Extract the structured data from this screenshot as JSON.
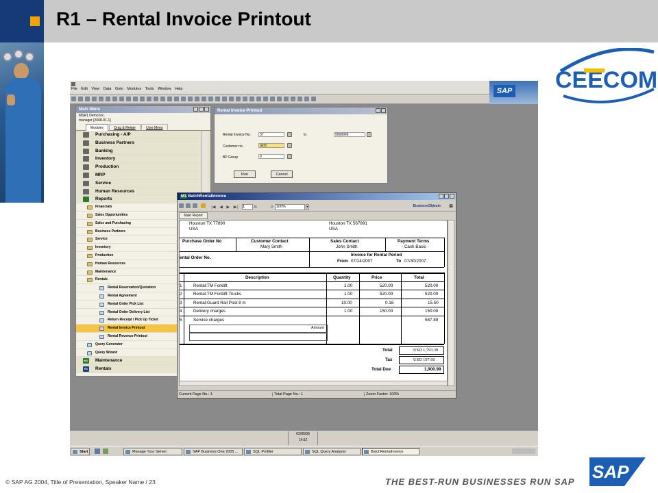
{
  "slide": {
    "title": "R1 – Rental Invoice Printout",
    "footer": "© SAP AG 2004, Title of Presentation, Speaker Name / 23",
    "tagline": "THE BEST-RUN BUSINESSES RUN SAP",
    "logo_text": "CEECOM",
    "sap_logo": "SAP",
    "colors": {
      "header_bg": "#c9c9c9",
      "header_blue": "#163a78",
      "accent_orange": "#f0a400",
      "sap_blue": "#1c5fb2"
    }
  },
  "app": {
    "menubar": [
      "File",
      "Edit",
      "View",
      "Data",
      "Goto",
      "Modules",
      "Tools",
      "Window",
      "Help"
    ],
    "sap_logo": "SAP"
  },
  "main_menu": {
    "title": "Main Menu",
    "company": "MSR1 Demo Inc.",
    "user": "manager [2008-01-1]",
    "tabs": [
      "Modules",
      "Drag & Relate",
      "User Menu"
    ],
    "modules": [
      {
        "label": "Purchasing - A/P",
        "icon": "cart-icon"
      },
      {
        "label": "Business Partners",
        "icon": "people-icon"
      },
      {
        "label": "Banking",
        "icon": "bank-icon"
      },
      {
        "label": "Inventory",
        "icon": "boxes-icon"
      },
      {
        "label": "Production",
        "icon": "gear-icon"
      },
      {
        "label": "MRP",
        "icon": "mrp-icon"
      },
      {
        "label": "Service",
        "icon": "tools-icon"
      },
      {
        "label": "Human Resources",
        "icon": "person-icon"
      },
      {
        "label": "Reports",
        "icon": "reports-icon"
      }
    ],
    "report_folders": [
      "Financials",
      "Sales Opportunities",
      "Sales and Purchasing",
      "Business Partners",
      "Service",
      "Inventory",
      "Production",
      "Human Resources",
      "Maintenance",
      "Rentals"
    ],
    "rental_reports": [
      "Rental Reservation/Quotation",
      "Rental Agreement",
      "Rental Order Pick List",
      "Rental Order Delivery List",
      "Return Receipt / Pick Up Ticket",
      "Rental Invoice Printout",
      "Rental Revenue Printout"
    ],
    "selected": "Rental Invoice Printout",
    "tail_items": [
      "Query Generator",
      "Query Wizard"
    ],
    "extra_modules": [
      {
        "label": "Maintenance",
        "badge": "M1"
      },
      {
        "label": "Rentals",
        "badge": "R1"
      }
    ]
  },
  "criteria": {
    "title": "Rental Invoice Printout",
    "rental_invoice_label": "Rental Invoice No.",
    "rental_invoice_from": "37",
    "to_label": "to",
    "rental_invoice_to": "9999999",
    "customer_label": "Customer no.",
    "customer_value": "GDC",
    "bp_group_label": "BP Group",
    "bp_group_value": "0",
    "run": "Run",
    "cancel": "Cancel"
  },
  "report_window": {
    "title": "BatchRentalInvoice",
    "badge": "M1",
    "page_field": "1",
    "page_total": "/1",
    "zoom": "100%",
    "brand": "BusinessObjects",
    "tab": "Main Report",
    "status": {
      "current_page": "Current Page No.: 1",
      "total_page": "Total Page No.: 1",
      "zoom": "Zoom Factor: 100%"
    }
  },
  "invoice": {
    "bill_addr": [
      "Houston TX 77890",
      "USA"
    ],
    "ship_addr": [
      "Houston TX 567891",
      "USA"
    ],
    "header_cols": [
      {
        "label": "Purchase Order No",
        "value": ""
      },
      {
        "label": "Customer Contact",
        "value": "Mary Smith"
      },
      {
        "label": "Sales Contact",
        "value": "John Smith"
      },
      {
        "label": "Payment Terms",
        "value": "- Cash Basic -"
      }
    ],
    "rental_order_label": "ental Order No.",
    "rental_period_label": "Invoice for Rental Period",
    "from_label": "From",
    "from_date": "07/24/2007",
    "to_label": "To",
    "to_date": "07/30/2007",
    "columns": [
      "Description",
      "Quantity",
      "Price",
      "Total"
    ],
    "items": [
      {
        "no": "1",
        "desc": "Rental:TM Forklift",
        "qty": "1.00",
        "price": "520.00",
        "total": "520.00"
      },
      {
        "no": "2",
        "desc": "Rental:TM Forklift Trucks",
        "qty": "1.00",
        "price": "520.00",
        "total": "520.00"
      },
      {
        "no": "3",
        "desc": "Rental:Guard Rail Post 8 m",
        "qty": "10.00",
        "price": "0.16",
        "total": "15.50"
      },
      {
        "no": "4",
        "desc": "Delivery charges",
        "qty": "1.00",
        "price": "150.00",
        "total": "150.00"
      },
      {
        "no": "5",
        "desc": "Service charges",
        "qty": "",
        "price": "",
        "total": "587.89"
      }
    ],
    "amount_label": "Amount",
    "total_label": "Total",
    "total_value": "USD 1,793.39",
    "tax_label": "Tax",
    "tax_value": "USD 107.60",
    "total_due_label": "Total Due",
    "total_due_value": "1,900.99"
  },
  "statusbar": {
    "date": "02/05/08",
    "time": "14:52"
  },
  "taskbar": {
    "start": "Start",
    "items": [
      "Manage Your Server",
      "SAP Business One 2005 ...",
      "SQL Profiler",
      "SQL Query Analyzer",
      "BatchRentalInvoice"
    ]
  }
}
